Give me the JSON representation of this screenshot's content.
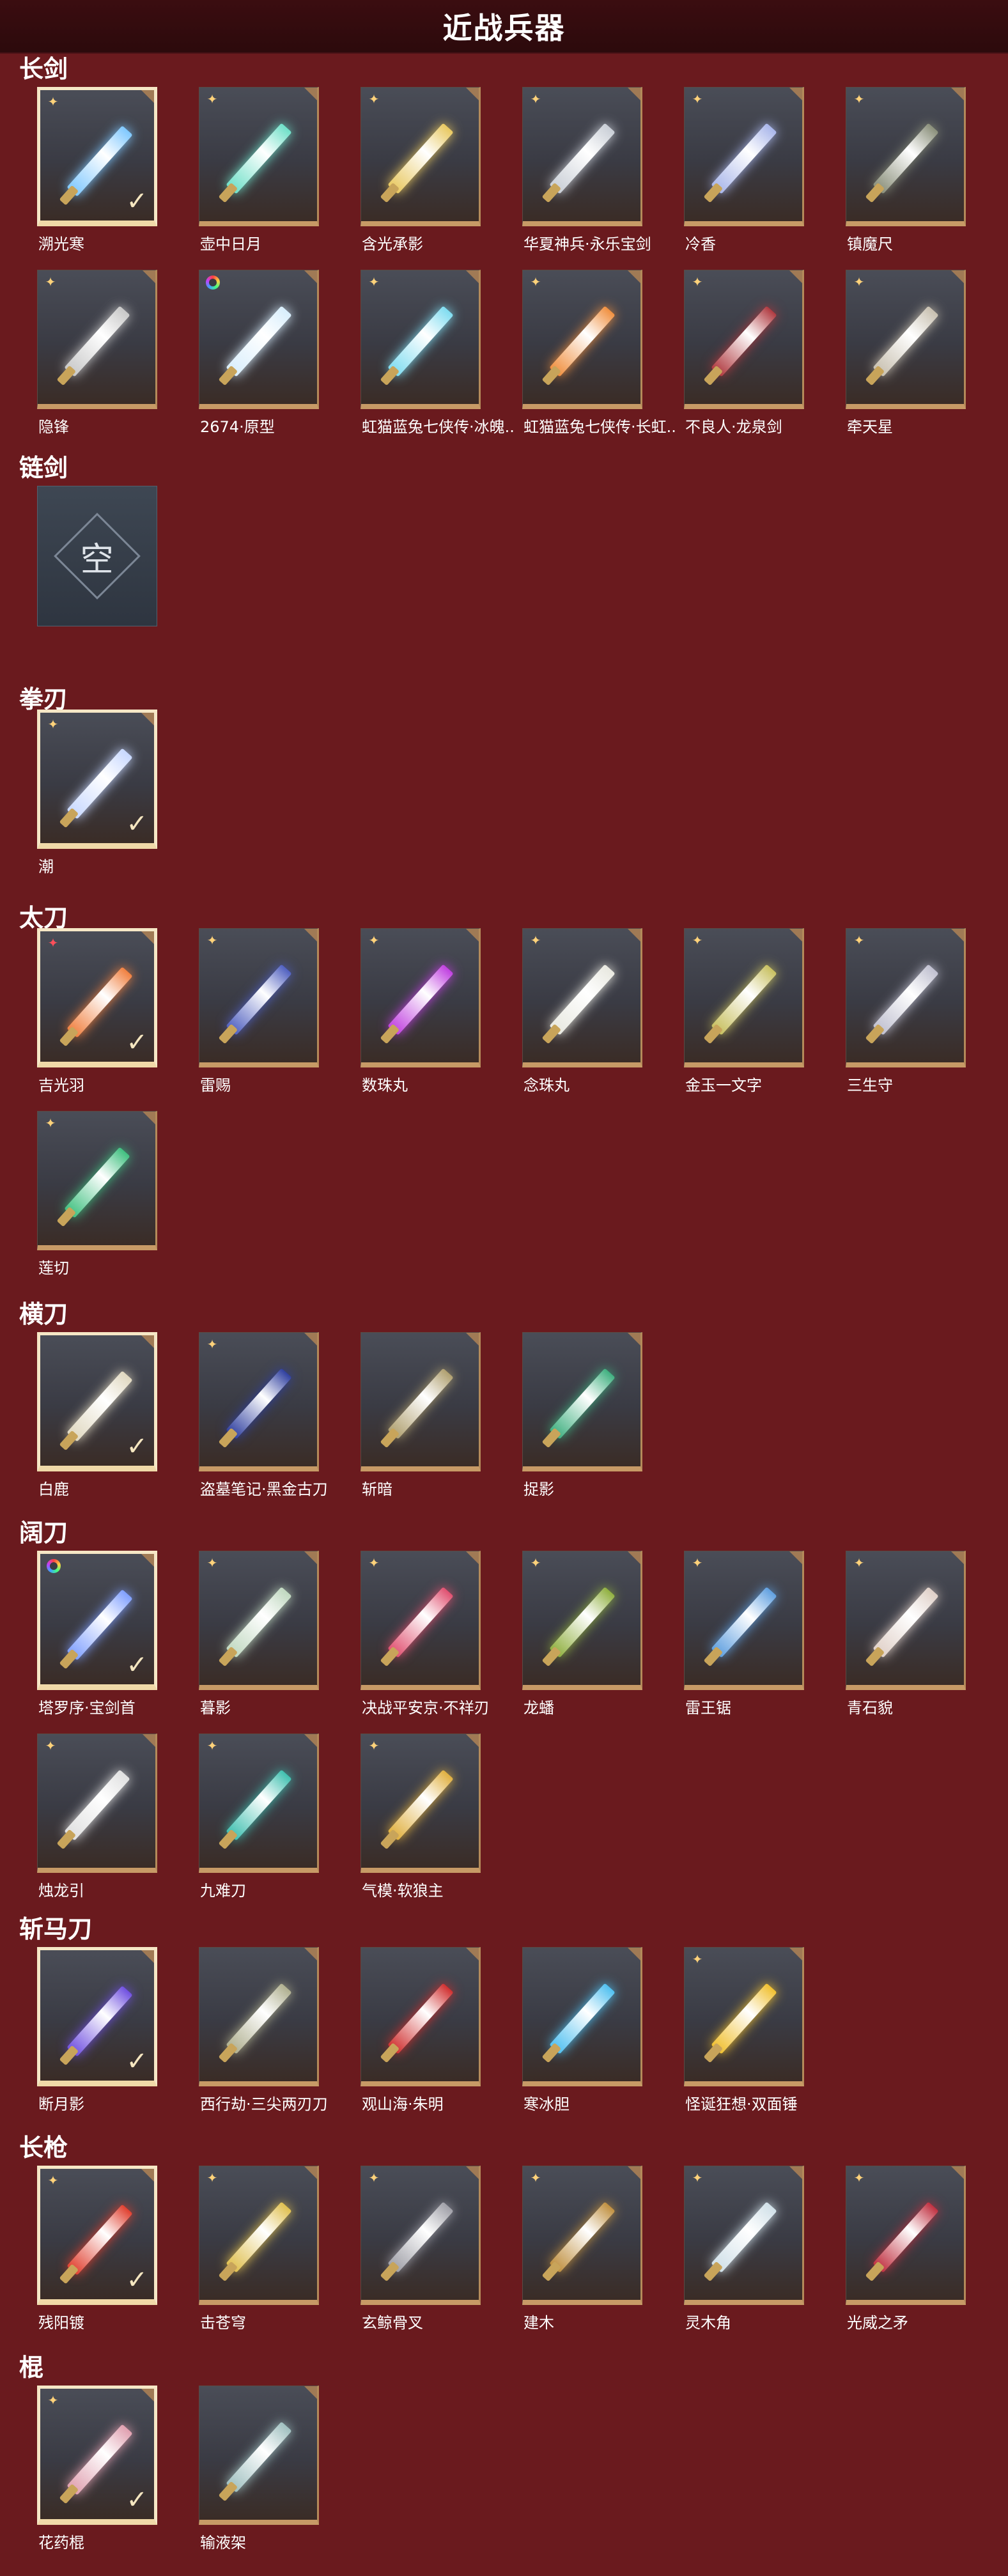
{
  "page": {
    "title": "近战兵器"
  },
  "empty_label": "空",
  "sections": [
    {
      "title": "长剑",
      "items": [
        {
          "name": "溯光寒",
          "selected": true,
          "tag": "star",
          "color": "#7fc8ff"
        },
        {
          "name": "壶中日月",
          "tag": "star",
          "color": "#6fe0c8"
        },
        {
          "name": "含光承影",
          "tag": "star",
          "color": "#e8c860"
        },
        {
          "name": "华夏神兵·永乐宝剑",
          "tag": "star",
          "color": "#c9ced6"
        },
        {
          "name": "冷香",
          "tag": "star",
          "color": "#a9b6ea"
        },
        {
          "name": "镇魔尺",
          "tag": "star",
          "color": "#8a8f7a"
        },
        {
          "name": "隐锋",
          "tag": "star",
          "color": "#c8c8c8"
        },
        {
          "name": "2674·原型",
          "tag": "rainbow",
          "color": "#d8eefc"
        },
        {
          "name": "虹猫蓝兔七侠传·冰魄..",
          "tag": "star",
          "color": "#7fdcf0"
        },
        {
          "name": "虹猫蓝兔七侠传·长虹..",
          "tag": "star",
          "color": "#f09040"
        },
        {
          "name": "不良人·龙泉剑",
          "tag": "star",
          "color": "#b03a40"
        },
        {
          "name": "牵天星",
          "tag": "star",
          "color": "#c8c0b0"
        }
      ]
    },
    {
      "title": "链剑",
      "empty": true,
      "items": []
    },
    {
      "title": "拳刃",
      "items": [
        {
          "name": "潮",
          "selected": true,
          "tag": "star",
          "color": "#c8d8ff"
        }
      ]
    },
    {
      "title": "太刀",
      "items": [
        {
          "name": "吉光羽",
          "selected": true,
          "tag": "red",
          "color": "#f08040"
        },
        {
          "name": "雷赐",
          "tag": "star",
          "color": "#5060c0"
        },
        {
          "name": "数珠丸",
          "tag": "star",
          "color": "#c040e0"
        },
        {
          "name": "念珠丸",
          "tag": "star",
          "color": "#e8e8e0"
        },
        {
          "name": "金玉一文字",
          "tag": "star",
          "color": "#c8c060"
        },
        {
          "name": "三生守",
          "tag": "star",
          "color": "#c0c0d0"
        },
        {
          "name": "莲切",
          "tag": "star",
          "color": "#40c080"
        }
      ]
    },
    {
      "title": "横刀",
      "items": [
        {
          "name": "白鹿",
          "selected": true,
          "tag": "none",
          "color": "#e0d8c0"
        },
        {
          "name": "盗墓笔记·黑金古刀",
          "tag": "star",
          "color": "#3040a0"
        },
        {
          "name": "斩暗",
          "tag": "none",
          "color": "#b0a070"
        },
        {
          "name": "捉影",
          "tag": "none",
          "color": "#40b080"
        }
      ]
    },
    {
      "title": "阔刀",
      "items": [
        {
          "name": "塔罗序·宝剑首",
          "selected": true,
          "tag": "rainbow",
          "color": "#80a0ff"
        },
        {
          "name": "暮影",
          "tag": "star",
          "color": "#c0d8c0"
        },
        {
          "name": "决战平安京·不祥刃",
          "tag": "star",
          "color": "#e05070"
        },
        {
          "name": "龙蟠",
          "tag": "star",
          "color": "#90b040"
        },
        {
          "name": "雷王锯",
          "tag": "star",
          "color": "#60a0e0"
        },
        {
          "name": "青石貌",
          "tag": "star",
          "color": "#e0d0c8"
        },
        {
          "name": "烛龙引",
          "tag": "star",
          "color": "#e0e0e0"
        },
        {
          "name": "九难刀",
          "tag": "star",
          "color": "#40c0b0"
        },
        {
          "name": "气模·软狼主",
          "tag": "star",
          "color": "#e0b040"
        }
      ]
    },
    {
      "title": "斩马刀",
      "items": [
        {
          "name": "断月影",
          "selected": true,
          "tag": "none",
          "color": "#7050e0"
        },
        {
          "name": "西行劫·三尖两刃刀",
          "tag": "none",
          "color": "#b0b090"
        },
        {
          "name": "观山海·朱明",
          "tag": "none",
          "color": "#d03030"
        },
        {
          "name": "寒冰胆",
          "tag": "none",
          "color": "#50c0f0"
        },
        {
          "name": "怪诞狂想·双面锤",
          "tag": "star",
          "color": "#f0c030"
        }
      ]
    },
    {
      "title": "长枪",
      "items": [
        {
          "name": "残阳镀",
          "selected": true,
          "tag": "star",
          "color": "#e04030"
        },
        {
          "name": "击苍穹",
          "tag": "star",
          "color": "#e0c050"
        },
        {
          "name": "玄鲸骨叉",
          "tag": "star",
          "color": "#a0a0a8"
        },
        {
          "name": "建木",
          "tag": "star",
          "color": "#c09040"
        },
        {
          "name": "灵木角",
          "tag": "star",
          "color": "#d0e0e8"
        },
        {
          "name": "光威之矛",
          "tag": "star",
          "color": "#c03040"
        }
      ]
    },
    {
      "title": "棍",
      "items": [
        {
          "name": "花药棍",
          "selected": true,
          "tag": "star",
          "color": "#e0a0b0"
        },
        {
          "name": "输液架",
          "tag": "none",
          "color": "#a0c0c0"
        }
      ]
    }
  ]
}
